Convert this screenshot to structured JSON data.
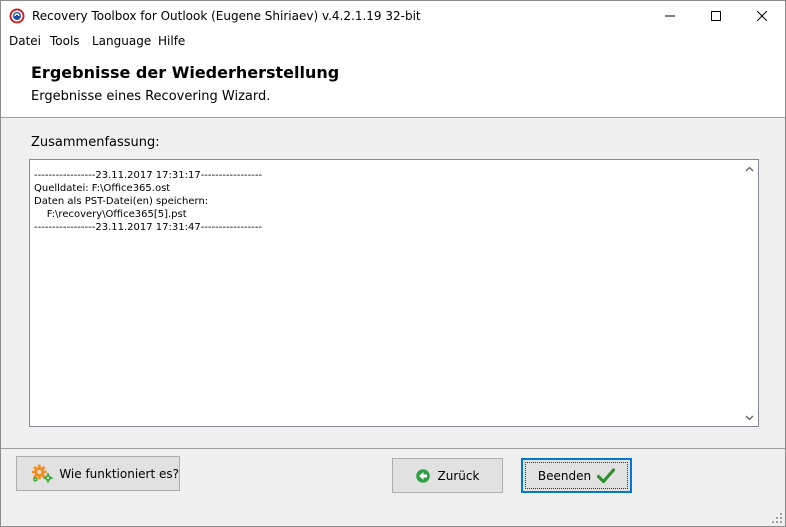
{
  "window": {
    "title": "Recovery Toolbox for Outlook (Eugene Shiriaev) v.4.2.1.19 32-bit",
    "icon": "app-logo-icon",
    "controls": [
      "minimize-icon",
      "maximize-icon",
      "close-icon"
    ]
  },
  "menu": {
    "items": [
      "Datei",
      "Tools",
      "Language",
      "Hilfe"
    ]
  },
  "header": {
    "title": "Ergebnisse der Wiederherstellung",
    "subtitle": "Ergebnisse eines Recovering Wizard."
  },
  "summary": {
    "label": "Zusammenfassung:",
    "log": "-----------------23.11.2017 17:31:17-----------------\nQuelldatei: F:\\Office365.ost\nDaten als PST-Datei(en) speichern:\n    F:\\recovery\\Office365[5].pst\n-----------------23.11.2017 17:31:47-----------------"
  },
  "buttons": {
    "help": "Wie funktioniert es?",
    "back": "Zurück",
    "finish": "Beenden"
  },
  "colors": {
    "accent": "#0078d7",
    "back_icon": "#2ea043",
    "check_icon": "#2f8f2f",
    "gear_orange": "#f28c1b",
    "gear_green": "#3aa83a"
  }
}
